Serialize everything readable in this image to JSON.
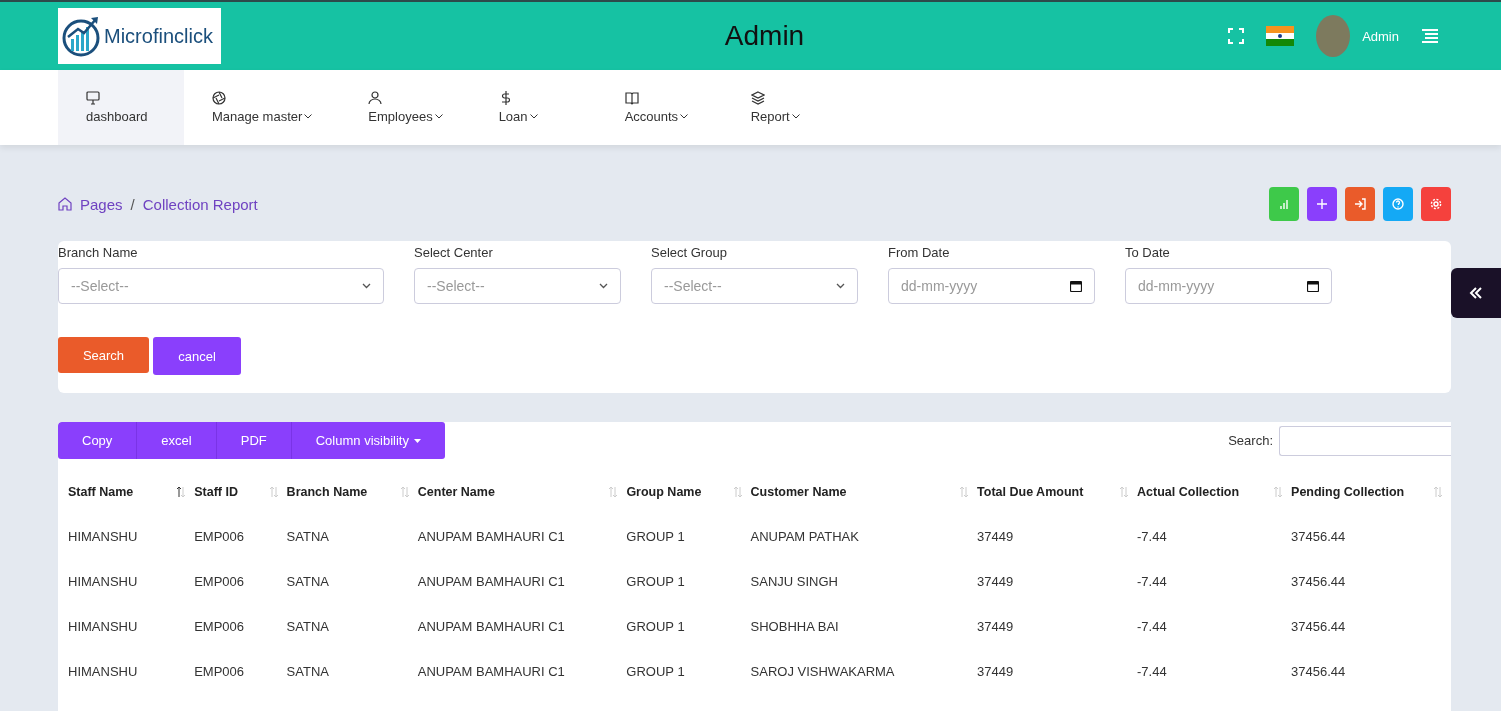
{
  "header": {
    "logo_text": "Microfinclick",
    "title": "Admin",
    "user_name": "Admin"
  },
  "nav": [
    {
      "label": "dashboard",
      "has_dropdown": false,
      "selected": true
    },
    {
      "label": "Manage master",
      "has_dropdown": true,
      "selected": false
    },
    {
      "label": "Employees",
      "has_dropdown": true,
      "selected": false
    },
    {
      "label": "Loan",
      "has_dropdown": true,
      "selected": false
    },
    {
      "label": "Accounts",
      "has_dropdown": true,
      "selected": false
    },
    {
      "label": "Report",
      "has_dropdown": true,
      "selected": false
    }
  ],
  "breadcrumb": {
    "items": [
      "Pages",
      "Collection Report"
    ],
    "separator": "/"
  },
  "action_buttons": [
    {
      "color": "#3ec94a"
    },
    {
      "color": "#8a3ffc"
    },
    {
      "color": "#ea5b2a"
    },
    {
      "color": "#14a9f5"
    },
    {
      "color": "#f5413d"
    }
  ],
  "filters": [
    {
      "label": "Branch Name",
      "kind": "select",
      "placeholder": "--Select--"
    },
    {
      "label": "Select Center",
      "kind": "select",
      "placeholder": "--Select--"
    },
    {
      "label": "Select Group",
      "kind": "select",
      "placeholder": "--Select--"
    },
    {
      "label": "From Date",
      "kind": "date",
      "placeholder": "dd-mm-yyyy"
    },
    {
      "label": "To Date",
      "kind": "date",
      "placeholder": "dd-mm-yyyy"
    }
  ],
  "filter_buttons": [
    {
      "label": "Search",
      "kind": "primary"
    },
    {
      "label": "cancel",
      "kind": "secondary"
    }
  ],
  "export_buttons": [
    {
      "label": "Copy",
      "has_dropdown": false
    },
    {
      "label": "excel",
      "has_dropdown": false
    },
    {
      "label": "PDF",
      "has_dropdown": false
    },
    {
      "label": "Column visibility",
      "has_dropdown": true
    }
  ],
  "table_search": {
    "label": "Search:"
  },
  "table": {
    "columns": [
      {
        "label": "Staff Name",
        "sorted": true
      },
      {
        "label": "Staff ID",
        "sorted": false
      },
      {
        "label": "Branch Name",
        "sorted": false
      },
      {
        "label": "Center Name",
        "sorted": false
      },
      {
        "label": "Group Name",
        "sorted": false
      },
      {
        "label": "Customer Name",
        "sorted": false
      },
      {
        "label": "Total Due Amount",
        "sorted": false
      },
      {
        "label": "Actual Collection",
        "sorted": false
      },
      {
        "label": "Pending Collection",
        "sorted": false
      }
    ],
    "rows": [
      [
        "HIMANSHU",
        "EMP006",
        "SATNA",
        "ANUPAM BAMHAURI C1",
        "GROUP 1",
        "ANUPAM PATHAK",
        "37449",
        "-7.44",
        "37456.44"
      ],
      [
        "HIMANSHU",
        "EMP006",
        "SATNA",
        "ANUPAM BAMHAURI C1",
        "GROUP 1",
        "SANJU SINGH",
        "37449",
        "-7.44",
        "37456.44"
      ],
      [
        "HIMANSHU",
        "EMP006",
        "SATNA",
        "ANUPAM BAMHAURI C1",
        "GROUP 1",
        "SHOBHHA BAI",
        "37449",
        "-7.44",
        "37456.44"
      ],
      [
        "HIMANSHU",
        "EMP006",
        "SATNA",
        "ANUPAM BAMHAURI C1",
        "GROUP 1",
        "SAROJ VISHWAKARMA",
        "37449",
        "-7.44",
        "37456.44"
      ]
    ]
  }
}
